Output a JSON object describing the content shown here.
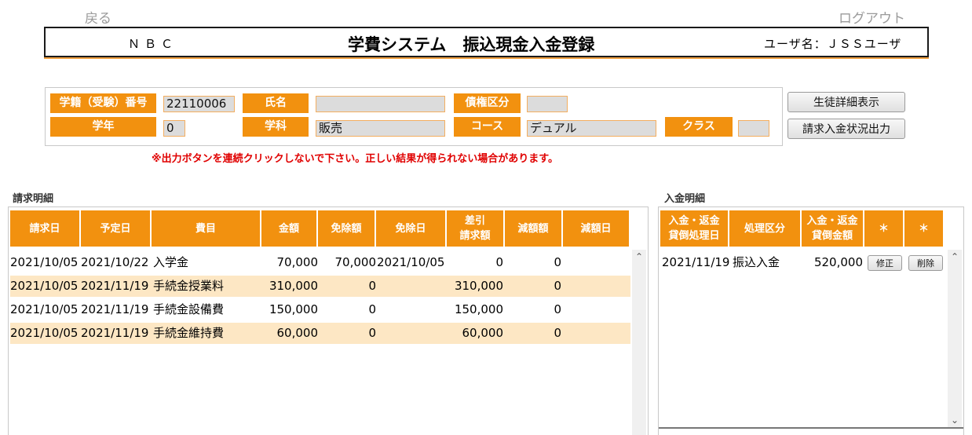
{
  "nav": {
    "back": "戻る",
    "logout": "ログアウト"
  },
  "header": {
    "company": "ＮＢＣ",
    "title": "学費システム　振込現金入金登録",
    "user": "ユーザ名：ＪＳＳユーザ"
  },
  "student": {
    "id_label": "学籍（受験）番号",
    "id_value": "22110006",
    "name_label": "氏名",
    "name_value": "",
    "credit_label": "債権区分",
    "credit_value": "",
    "year_label": "学年",
    "year_value": "0",
    "dept_label": "学科",
    "dept_value": "販売",
    "course_label": "コース",
    "course_value": "デュアル",
    "class_label": "クラス",
    "class_value": ""
  },
  "buttons": {
    "detail": "生徒詳細表示",
    "output": "請求入金状況出力"
  },
  "warning": "※出力ボタンを連続クリックしないで下さい。正しい結果が得られない場合があります。",
  "billing": {
    "title": "請求明細",
    "headers": [
      "請求日",
      "予定日",
      "費目",
      "金額",
      "免除額",
      "免除日",
      "差引\n請求額",
      "減額額",
      "減額日"
    ],
    "rows": [
      [
        "2021/10/05",
        "2021/10/22",
        "入学金",
        "70,000",
        "70,000",
        "2021/10/05",
        "0",
        "0",
        ""
      ],
      [
        "2021/10/05",
        "2021/11/19",
        "手続金授業料",
        "310,000",
        "0",
        "",
        "310,000",
        "0",
        ""
      ],
      [
        "2021/10/05",
        "2021/11/19",
        "手続金設備費",
        "150,000",
        "0",
        "",
        "150,000",
        "0",
        ""
      ],
      [
        "2021/10/05",
        "2021/11/19",
        "手続金維持費",
        "60,000",
        "0",
        "",
        "60,000",
        "0",
        ""
      ]
    ]
  },
  "payment": {
    "title": "入金明細",
    "headers": [
      "入金・返金\n貸倒処理日",
      "処理区分",
      "入金・返金\n貸倒金額",
      "＊",
      "＊"
    ],
    "rows": [
      {
        "date": "2021/11/19",
        "type": "振込入金",
        "amount": "520,000",
        "edit": "修正",
        "delete": "削除"
      }
    ]
  },
  "colors": {
    "accent": "#f2910f",
    "row_alt": "#fde7c4",
    "warning": "#e00000"
  },
  "icons": {
    "scroll_up": "chevron-up-icon",
    "scroll_down": "chevron-down-icon"
  }
}
